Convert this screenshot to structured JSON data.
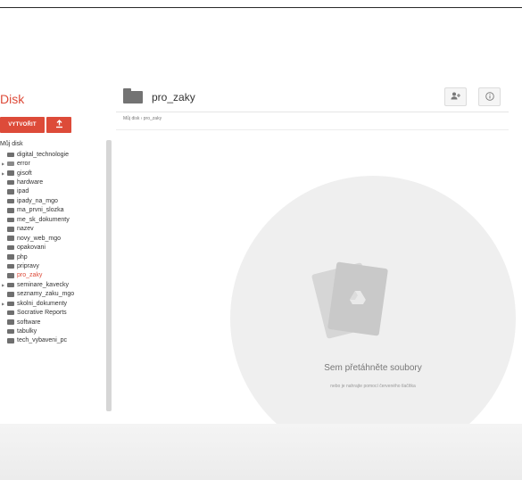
{
  "app": {
    "brand": "Disk"
  },
  "sidebar": {
    "create_label": "VYTVOŘIT",
    "upload_icon": "upload-icon",
    "root_label": "Můj disk",
    "items": [
      {
        "label": "digital_technologie",
        "expandable": false,
        "icon": "folder-icon"
      },
      {
        "label": "error",
        "expandable": true,
        "icon": "shared-folder-icon"
      },
      {
        "label": "gisoft",
        "expandable": true,
        "icon": "folder-icon"
      },
      {
        "label": "hardware",
        "expandable": false,
        "icon": "folder-icon"
      },
      {
        "label": "ipad",
        "expandable": false,
        "icon": "folder-icon"
      },
      {
        "label": "ipady_na_mgo",
        "expandable": false,
        "icon": "folder-icon"
      },
      {
        "label": "ma_prvni_slozka",
        "expandable": false,
        "icon": "folder-icon"
      },
      {
        "label": "me_sk_dokumenty",
        "expandable": false,
        "icon": "folder-icon"
      },
      {
        "label": "nazev",
        "expandable": false,
        "icon": "folder-icon"
      },
      {
        "label": "novy_web_mgo",
        "expandable": false,
        "icon": "folder-icon"
      },
      {
        "label": "opakovani",
        "expandable": false,
        "icon": "folder-icon"
      },
      {
        "label": "php",
        "expandable": false,
        "icon": "folder-icon"
      },
      {
        "label": "pripravy",
        "expandable": false,
        "icon": "folder-icon"
      },
      {
        "label": "pro_zaky",
        "expandable": false,
        "icon": "folder-icon",
        "active": true
      },
      {
        "label": "seminare_kavecky",
        "expandable": true,
        "icon": "folder-icon"
      },
      {
        "label": "seznamy_zaku_mgo",
        "expandable": false,
        "icon": "folder-icon"
      },
      {
        "label": "skolni_dokumenty",
        "expandable": true,
        "icon": "folder-icon"
      },
      {
        "label": "Socrative Reports",
        "expandable": false,
        "icon": "folder-icon"
      },
      {
        "label": "software",
        "expandable": false,
        "icon": "folder-icon"
      },
      {
        "label": "tabulky",
        "expandable": false,
        "icon": "folder-icon"
      },
      {
        "label": "tech_vybaveni_pc",
        "expandable": false,
        "icon": "folder-icon"
      }
    ]
  },
  "header": {
    "folder_title": "pro_zaky",
    "share_icon": "add-person-icon",
    "info_icon": "info-icon"
  },
  "breadcrumb": {
    "text": "Můj disk  ›  pro_zaky"
  },
  "drop_zone": {
    "main_text": "Sem přetáhněte soubory",
    "sub_text": "nebo je nahrajte pomocí červeného tlačítka"
  },
  "colors": {
    "accent": "#dd4b39",
    "active_text": "#dd4b39"
  }
}
